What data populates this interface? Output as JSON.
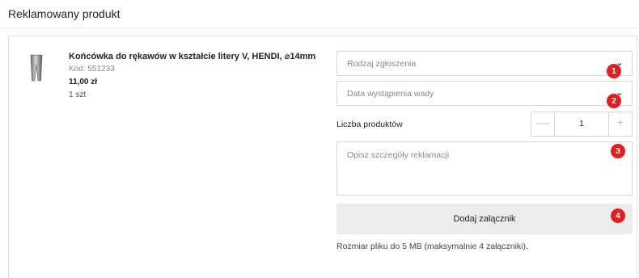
{
  "section": {
    "title": "Reklamowany produkt"
  },
  "product": {
    "name": "Końcówka do rękawów w kształcie litery V, HENDI, ⌀14mm",
    "code": "Kod: 551233",
    "price": "11,00 zł",
    "quantity": "1 szt"
  },
  "form": {
    "report_type": {
      "placeholder": "Rodzaj zgłoszenia",
      "chevron": "⌄"
    },
    "defect_date": {
      "placeholder": "Data wystąpienia wady",
      "chevron": "⌄"
    },
    "product_count": {
      "label": "Liczba produktów",
      "minus": "—",
      "value": "1",
      "plus": "+"
    },
    "details": {
      "placeholder": "Opisz szczegóły reklamacji"
    },
    "attachment": {
      "button_label": "Dodaj załącznik",
      "hint": "Rozmiar pliku do 5 MB (maksymalnie 4 załączniki)."
    }
  },
  "markers": [
    "1",
    "2",
    "3",
    "4"
  ],
  "colors": {
    "marker": "#e02020",
    "button_bg": "#ececec",
    "border": "#d8d8d8"
  }
}
